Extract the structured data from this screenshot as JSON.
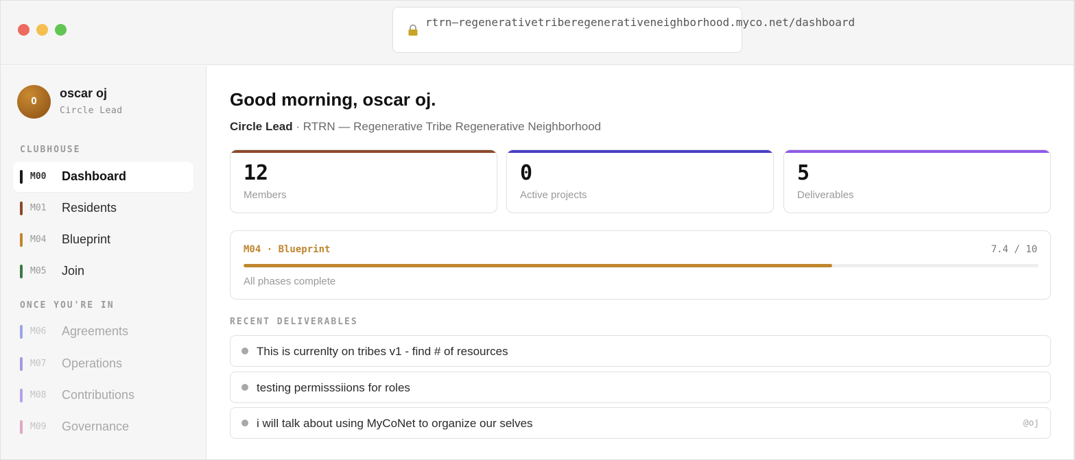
{
  "browser": {
    "url": "rtrn—regenerativetriberegenerativeneighborhood.myco.net/dashboard",
    "lock_icon": "lock-icon"
  },
  "user": {
    "avatar_initial": "O",
    "name": "oscar oj",
    "role": "Circle Lead"
  },
  "sidebar": {
    "section_1_label": "CLUBHOUSE",
    "section_2_label": "ONCE YOU'RE IN",
    "items": [
      {
        "code": "M00",
        "label": "Dashboard",
        "color": "#1a1a1a"
      },
      {
        "code": "M01",
        "label": "Residents",
        "color": "#8b4a2b"
      },
      {
        "code": "M04",
        "label": "Blueprint",
        "color": "#c0862f"
      },
      {
        "code": "M05",
        "label": "Join",
        "color": "#3d7a45"
      },
      {
        "code": "M06",
        "label": "Agreements",
        "color": "#9aa6e6"
      },
      {
        "code": "M07",
        "label": "Operations",
        "color": "#a49ae0"
      },
      {
        "code": "M08",
        "label": "Contributions",
        "color": "#b8a0e8"
      },
      {
        "code": "M09",
        "label": "Governance",
        "color": "#e0a8c4"
      }
    ]
  },
  "main": {
    "greeting": "Good morning, oscar oj.",
    "role": "Circle Lead",
    "org_line": " · RTRN — Regenerative Tribe Regenerative Neighborhood",
    "stats": [
      {
        "value": "12",
        "label": "Members",
        "color": "#8b4a2b"
      },
      {
        "value": "0",
        "label": "Active projects",
        "color": "#4a3fc4"
      },
      {
        "value": "5",
        "label": "Deliverables",
        "color": "#8f5ae8"
      }
    ],
    "blueprint": {
      "title": "M04 · Blueprint",
      "score": "7.4 / 10",
      "progress": 0.74,
      "status": "All phases complete",
      "color": "#c0862f"
    },
    "recent_label": "RECENT DELIVERABLES",
    "deliverables": [
      {
        "text": "This is currenlty on tribes v1 - find # of resources",
        "author": ""
      },
      {
        "text": "testing permisssiions for roles",
        "author": ""
      },
      {
        "text": "i will talk about using MyCoNet to organize our selves",
        "author": "@oj"
      }
    ]
  }
}
